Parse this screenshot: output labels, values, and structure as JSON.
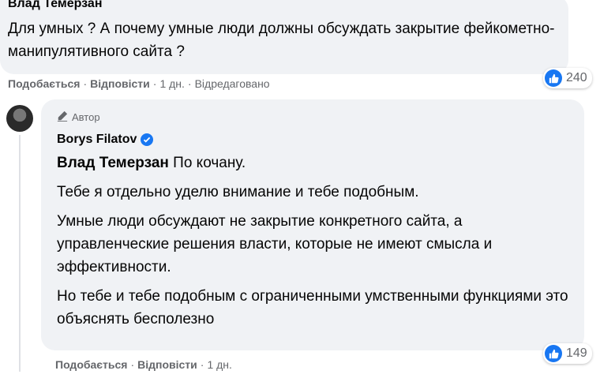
{
  "comment1": {
    "author": "Влад Темерзан",
    "text": "Для умных ? А почему умные люди должны обсуждать закрытие фейкометно-манипулятивного сайта ?",
    "actions": {
      "like": "Подобається",
      "reply": "Відповісти",
      "time": "1 дн.",
      "edited": "Відредаговано"
    },
    "reaction_count": "240"
  },
  "comment2": {
    "badge": "Автор",
    "author": "Borys Filatov",
    "mention": "Влад Темерзан",
    "first_line": " По кочану.",
    "paragraphs": [
      "Тебе я отдельно уделю внимание и тебе подобным.",
      "Умные люди обсуждают не закрытие конкретного сайта, а управленческие решения власти, которые не имеют смысла и эффективности.",
      "Но тебе и тебе подобным с ограниченными умственными функциями это объяснять бесполезно"
    ],
    "actions": {
      "like": "Подобається",
      "reply": "Відповісти",
      "time": "1 дн."
    },
    "reaction_count": "149"
  },
  "colors": {
    "like_blue": "#1877f2",
    "bubble_bg": "#f0f2f5",
    "meta_gray": "#65676b"
  }
}
